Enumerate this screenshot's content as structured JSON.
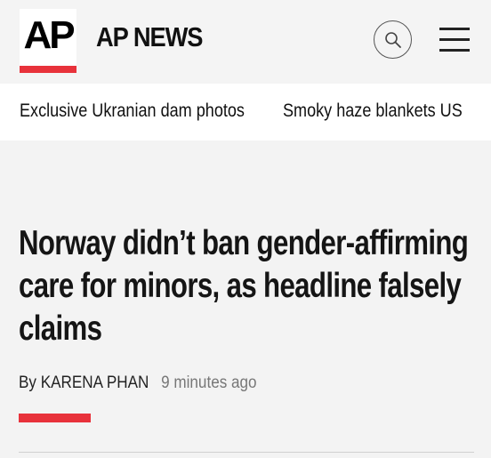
{
  "header": {
    "logo_text": "AP",
    "brand_name": "AP NEWS",
    "search_icon": "search-icon",
    "menu_icon": "hamburger-menu-icon"
  },
  "trending": {
    "items": [
      {
        "label": "Exclusive Ukranian dam photos"
      },
      {
        "label": "Smoky haze blankets US"
      }
    ]
  },
  "article": {
    "headline": "Norway didn’t ban gender-affirming care for minors, as headline falsely claims",
    "byline_prefix": "By",
    "author": "KARENA PHAN",
    "timestamp": "9 minutes ago"
  },
  "colors": {
    "accent": "#e8323b",
    "background": "#f3f3f3",
    "text": "#151515",
    "muted": "#777777"
  }
}
